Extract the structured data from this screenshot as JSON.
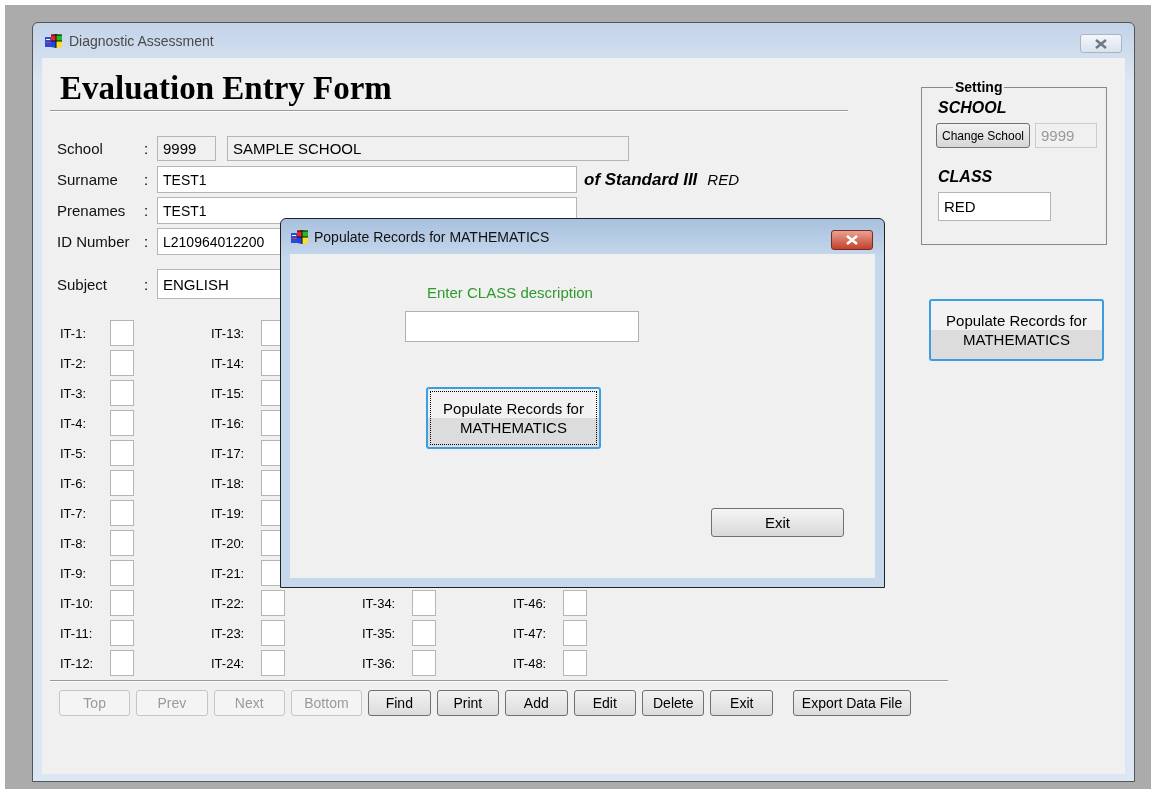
{
  "window": {
    "title": "Diagnostic Assessment"
  },
  "form": {
    "heading": "Evaluation Entry Form",
    "school": {
      "label": "School",
      "separator": ":",
      "code": "9999",
      "name": "SAMPLE SCHOOL"
    },
    "surname": {
      "label": "Surname",
      "separator": ":",
      "value": "TEST1"
    },
    "standard": "of Standard III",
    "class_name": "RED",
    "prenames": {
      "label": "Prenames",
      "separator": ":",
      "value": "TEST1"
    },
    "id_number": {
      "label": "ID Number",
      "separator": ":",
      "value": "L210964012200"
    },
    "subject": {
      "label": "Subject",
      "separator": ":",
      "value": "ENGLISH"
    }
  },
  "item_columns": [
    {
      "items": [
        {
          "label": "IT-1:"
        },
        {
          "label": "IT-2:"
        },
        {
          "label": "IT-3:"
        },
        {
          "label": "IT-4:"
        },
        {
          "label": "IT-5:"
        },
        {
          "label": "IT-6:"
        },
        {
          "label": "IT-7:"
        },
        {
          "label": "IT-8:"
        },
        {
          "label": "IT-9:"
        },
        {
          "label": "IT-10:"
        },
        {
          "label": "IT-11:"
        },
        {
          "label": "IT-12:"
        }
      ]
    },
    {
      "items": [
        {
          "label": "IT-13:"
        },
        {
          "label": "IT-14:"
        },
        {
          "label": "IT-15:"
        },
        {
          "label": "IT-16:"
        },
        {
          "label": "IT-17:"
        },
        {
          "label": "IT-18:"
        },
        {
          "label": "IT-19:"
        },
        {
          "label": "IT-20:"
        },
        {
          "label": "IT-21:"
        },
        {
          "label": "IT-22:"
        },
        {
          "label": "IT-23:"
        },
        {
          "label": "IT-24:"
        }
      ]
    },
    {
      "items": [
        {
          "label": "IT-34:"
        },
        {
          "label": "IT-35:"
        },
        {
          "label": "IT-36:"
        }
      ]
    },
    {
      "items": [
        {
          "label": "IT-46:"
        },
        {
          "label": "IT-47:"
        },
        {
          "label": "IT-48:"
        }
      ]
    }
  ],
  "toolbar": [
    {
      "label": "Top",
      "disabled": true
    },
    {
      "label": "Prev",
      "disabled": true
    },
    {
      "label": "Next",
      "disabled": true
    },
    {
      "label": "Bottom",
      "disabled": true
    },
    {
      "label": "Find",
      "disabled": false
    },
    {
      "label": "Print",
      "disabled": false
    },
    {
      "label": "Add",
      "disabled": false
    },
    {
      "label": "Edit",
      "disabled": false
    },
    {
      "label": "Delete",
      "disabled": false
    },
    {
      "label": "Exit",
      "disabled": false
    }
  ],
  "export_button": "Export Data File",
  "setting": {
    "title": "Setting",
    "school_label": "SCHOOL",
    "change_button": "Change School",
    "school_code": "9999",
    "class_label": "CLASS",
    "class_value": "RED"
  },
  "populate_button": "Populate Records for MATHEMATICS",
  "dialog": {
    "title": "Populate Records for MATHEMATICS",
    "prompt": "Enter CLASS description",
    "populate_button": "Populate Records for MATHEMATICS",
    "exit_button": "Exit"
  }
}
